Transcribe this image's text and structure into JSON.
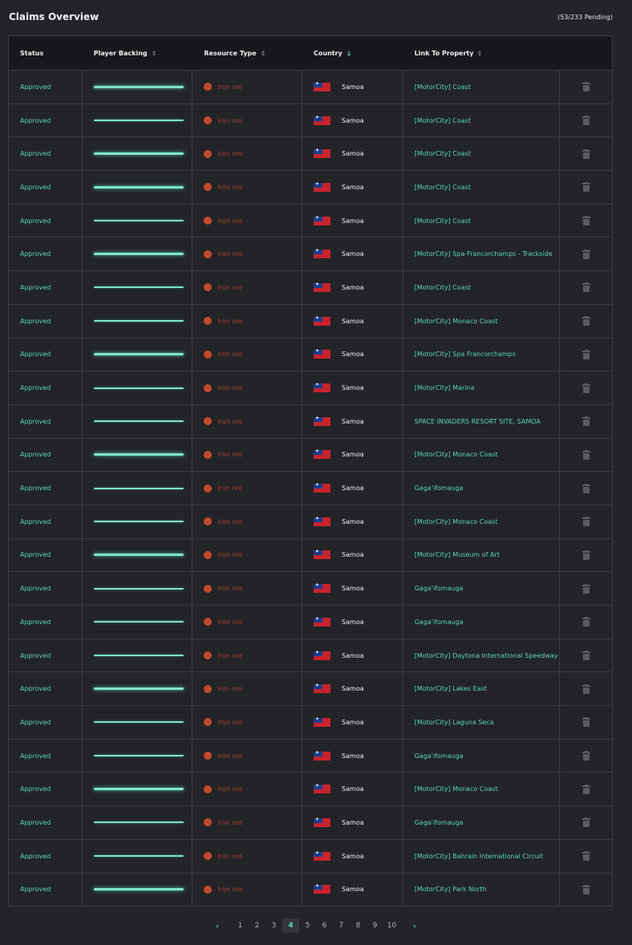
{
  "header": {
    "title": "Claims Overview",
    "pending": "(53/233 Pending)"
  },
  "columns": {
    "status": "Status",
    "backing": "Player Backing",
    "resource": "Resource Type",
    "country": "Country",
    "link": "Link To Property"
  },
  "icons": {
    "sort": "sort-icon",
    "delete": "trash-icon",
    "flag": "samoa-flag-icon",
    "resource": "resource-dot-icon"
  },
  "colors": {
    "accent": "#5ad7b3",
    "resource": "#c24a2c",
    "background": "#232428"
  },
  "rows": [
    {
      "status": "Approved",
      "backing": 1.0,
      "resource": "Iron ore",
      "country": "Samoa",
      "link": "[MotorCity] Coast"
    },
    {
      "status": "Approved",
      "backing": 1.0,
      "resource": "Iron ore",
      "country": "Samoa",
      "link": "[MotorCity] Coast"
    },
    {
      "status": "Approved",
      "backing": 1.0,
      "resource": "Iron ore",
      "country": "Samoa",
      "link": "[MotorCity] Coast"
    },
    {
      "status": "Approved",
      "backing": 1.0,
      "resource": "Iron ore",
      "country": "Samoa",
      "link": "[MotorCity] Coast"
    },
    {
      "status": "Approved",
      "backing": 1.0,
      "resource": "Iron ore",
      "country": "Samoa",
      "link": "[MotorCity] Coast"
    },
    {
      "status": "Approved",
      "backing": 1.0,
      "resource": "Iron ore",
      "country": "Samoa",
      "link": "[MotorCity] Spa-Francorchamps - Trackside"
    },
    {
      "status": "Approved",
      "backing": 1.0,
      "resource": "Iron ore",
      "country": "Samoa",
      "link": "[MotorCity] Coast"
    },
    {
      "status": "Approved",
      "backing": 1.0,
      "resource": "Iron ore",
      "country": "Samoa",
      "link": "[MotorCity] Monaco Coast"
    },
    {
      "status": "Approved",
      "backing": 1.0,
      "resource": "Iron ore",
      "country": "Samoa",
      "link": "[MotorCity] Spa Francorchamps"
    },
    {
      "status": "Approved",
      "backing": 1.0,
      "resource": "Iron ore",
      "country": "Samoa",
      "link": "[MotorCity] Marina"
    },
    {
      "status": "Approved",
      "backing": 1.0,
      "resource": "Iron ore",
      "country": "Samoa",
      "link": "SPACE INVADERS RESORT SITE, SAMOA"
    },
    {
      "status": "Approved",
      "backing": 1.0,
      "resource": "Iron ore",
      "country": "Samoa",
      "link": "[MotorCity] Monaco Coast"
    },
    {
      "status": "Approved",
      "backing": 1.0,
      "resource": "Iron ore",
      "country": "Samoa",
      "link": "Gaga'ifomauga"
    },
    {
      "status": "Approved",
      "backing": 1.0,
      "resource": "Iron ore",
      "country": "Samoa",
      "link": "[MotorCity] Monaco Coast"
    },
    {
      "status": "Approved",
      "backing": 1.0,
      "resource": "Iron ore",
      "country": "Samoa",
      "link": "[MotorCity] Museum of Art"
    },
    {
      "status": "Approved",
      "backing": 1.0,
      "resource": "Iron ore",
      "country": "Samoa",
      "link": "Gaga'ifomauga"
    },
    {
      "status": "Approved",
      "backing": 1.0,
      "resource": "Iron ore",
      "country": "Samoa",
      "link": "Gaga'ifomauga"
    },
    {
      "status": "Approved",
      "backing": 1.0,
      "resource": "Iron ore",
      "country": "Samoa",
      "link": "[MotorCity] Daytona International Speedway"
    },
    {
      "status": "Approved",
      "backing": 1.0,
      "resource": "Iron ore",
      "country": "Samoa",
      "link": "[MotorCity] Lakes East"
    },
    {
      "status": "Approved",
      "backing": 1.0,
      "resource": "Iron ore",
      "country": "Samoa",
      "link": "[MotorCity] Laguna Seca"
    },
    {
      "status": "Approved",
      "backing": 1.0,
      "resource": "Iron ore",
      "country": "Samoa",
      "link": "Gaga'ifomauga"
    },
    {
      "status": "Approved",
      "backing": 1.0,
      "resource": "Iron ore",
      "country": "Samoa",
      "link": "[MotorCity] Monaco Coast"
    },
    {
      "status": "Approved",
      "backing": 1.0,
      "resource": "Iron ore",
      "country": "Samoa",
      "link": "Gaga'ifomauga"
    },
    {
      "status": "Approved",
      "backing": 1.0,
      "resource": "Iron ore",
      "country": "Samoa",
      "link": "[MotorCity] Bahrain International Circuit"
    },
    {
      "status": "Approved",
      "backing": 1.0,
      "resource": "Iron ore",
      "country": "Samoa",
      "link": "[MotorCity] Park North"
    }
  ],
  "pagination": {
    "pages": [
      "1",
      "2",
      "3",
      "4",
      "5",
      "6",
      "7",
      "8",
      "9",
      "10"
    ],
    "current": "4",
    "prev": "‹",
    "next": "›"
  }
}
